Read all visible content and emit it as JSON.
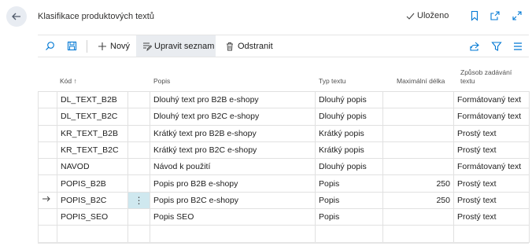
{
  "header": {
    "title": "Klasifikace produktových textů",
    "saved_label": "Uloženo"
  },
  "toolbar": {
    "new_label": "Nový",
    "edit_list_label": "Upravit seznam",
    "delete_label": "Odstranit"
  },
  "columns": {
    "code": "Kód",
    "sort_indicator": "↑",
    "description": "Popis",
    "text_type": "Typ textu",
    "max_length": "Maximální délka",
    "entry_mode_line1": "Způsob zadávání",
    "entry_mode_line2": "textu"
  },
  "rows": [
    {
      "code": "DL_TEXT_B2B",
      "description": "Dlouhý text pro B2B e-shopy",
      "text_type": "Dlouhý popis",
      "max_length": "",
      "entry_mode": "Formátovaný text"
    },
    {
      "code": "DL_TEXT_B2C",
      "description": "Dlouhý text pro B2C e-shopy",
      "text_type": "Dlouhý popis",
      "max_length": "",
      "entry_mode": "Formátovaný text"
    },
    {
      "code": "KR_TEXT_B2B",
      "description": "Krátký text pro B2B e-shopy",
      "text_type": "Krátký popis",
      "max_length": "",
      "entry_mode": "Prostý text"
    },
    {
      "code": "KR_TEXT_B2C",
      "description": "Krátký text pro B2C e-shopy",
      "text_type": "Krátký popis",
      "max_length": "",
      "entry_mode": "Prostý text"
    },
    {
      "code": "NAVOD",
      "description": "Návod k použití",
      "text_type": "Dlouhý popis",
      "max_length": "",
      "entry_mode": "Formátovaný text"
    },
    {
      "code": "POPIS_B2B",
      "description": "Popis pro B2B e-shopy",
      "text_type": "Popis",
      "max_length": "250",
      "entry_mode": "Prostý text"
    },
    {
      "code": "POPIS_B2C",
      "description": "Popis pro B2C e-shopy",
      "text_type": "Popis",
      "max_length": "250",
      "entry_mode": "Prostý text",
      "selected": true
    },
    {
      "code": "POPIS_SEO",
      "description": "Popis SEO",
      "text_type": "Popis",
      "max_length": "",
      "entry_mode": "Prostý text"
    },
    {
      "code": "",
      "description": "",
      "text_type": "",
      "max_length": "",
      "entry_mode": ""
    }
  ],
  "colors": {
    "accent": "#0078d4",
    "selected_cell": "#cfe8ef"
  },
  "icons": [
    "back-arrow-icon",
    "checkmark-icon",
    "bookmark-icon",
    "open-new-window-icon",
    "expand-icon",
    "search-icon",
    "save-view-icon",
    "plus-icon",
    "edit-list-icon",
    "trash-icon",
    "share-icon",
    "filter-icon",
    "list-view-icon",
    "row-arrow-icon",
    "more-options-icon"
  ]
}
